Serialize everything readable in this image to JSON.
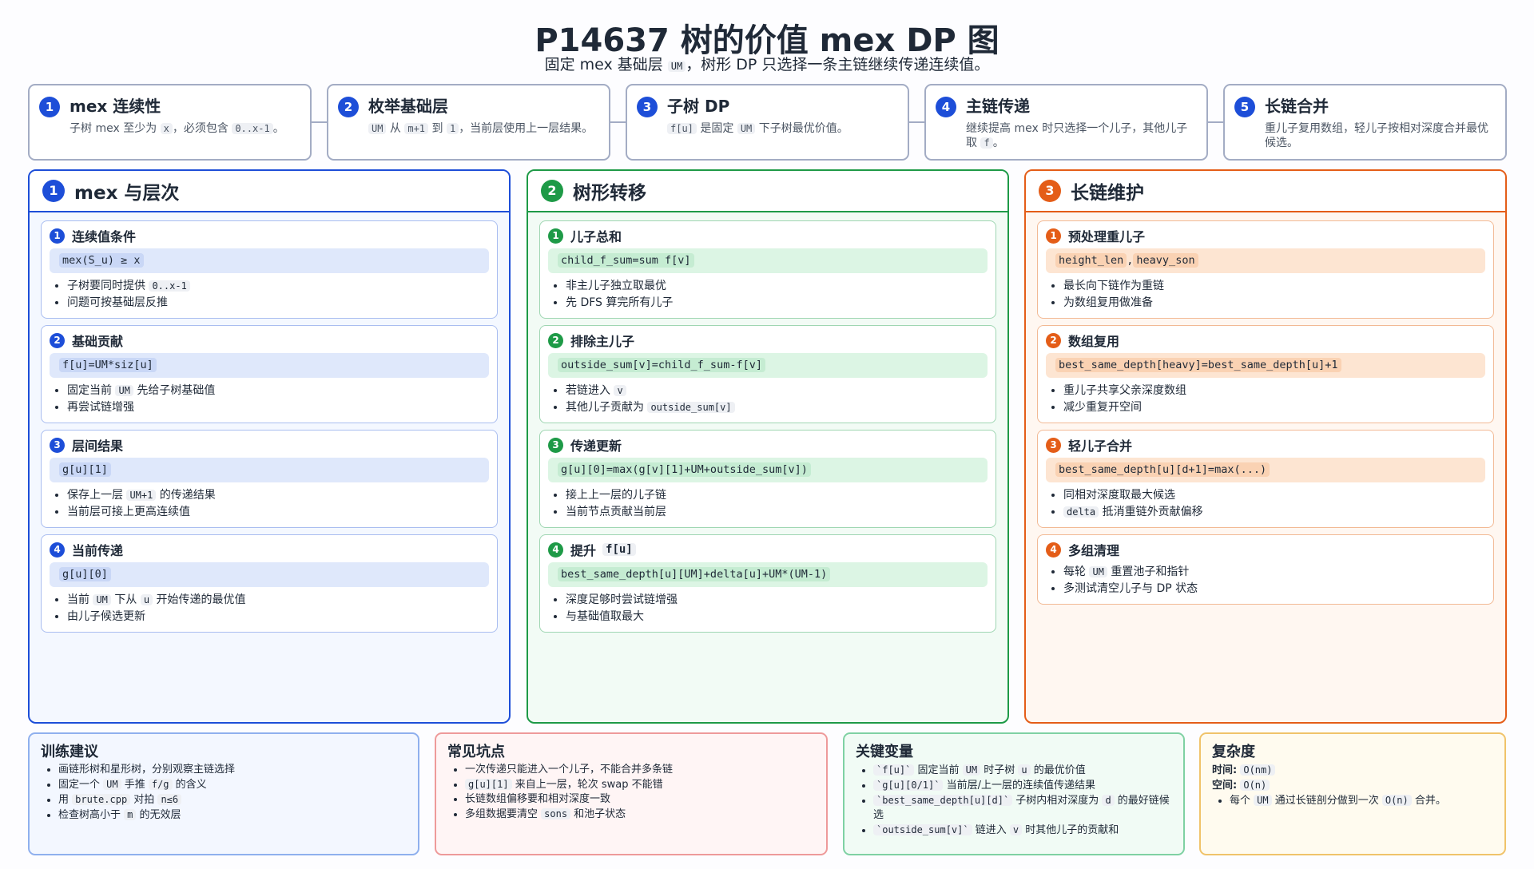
{
  "header": {
    "title": "P14637 树的价值 mex DP 图",
    "subtitle_pre": "固定 mex 基础层 ",
    "subtitle_code": "UM",
    "subtitle_post": "，树形 DP 只选择一条主链继续传递连续值。"
  },
  "steps": [
    {
      "num": "1",
      "title": "mex 连续性",
      "desc": [
        "子树 mex 至少为 ",
        {
          "c": "x"
        },
        "，必须包含 ",
        {
          "c": "0..x-1"
        },
        "。"
      ]
    },
    {
      "num": "2",
      "title": "枚举基础层",
      "desc": [
        {
          "c": "UM"
        },
        " 从 ",
        {
          "c": "m+1"
        },
        " 到 ",
        {
          "c": "1"
        },
        "，当前层使用上一层结果。"
      ]
    },
    {
      "num": "3",
      "title": "子树 DP",
      "desc": [
        {
          "c": "f[u]"
        },
        " 是固定 ",
        {
          "c": "UM"
        },
        " 下子树最优价值。"
      ]
    },
    {
      "num": "4",
      "title": "主链传递",
      "desc": [
        "继续提高 mex 时只选择一个儿子，其他儿子取 ",
        {
          "c": "f"
        },
        "。"
      ]
    },
    {
      "num": "5",
      "title": "长链合并",
      "desc": [
        "重儿子复用数组，轻儿子按相对深度合并最优候选。"
      ]
    }
  ],
  "columns": [
    {
      "num": "1",
      "title": "mex 与层次",
      "cards": [
        {
          "num": "1",
          "title": "连续值条件",
          "formula": [
            "mex(S_u) ≥ x"
          ],
          "bullets": [
            [
              "子树要同时提供 ",
              {
                "c": "0..x-1"
              }
            ],
            [
              "问题可按基础层反推"
            ]
          ]
        },
        {
          "num": "2",
          "title": "基础贡献",
          "formula": [
            "f[u]=UM*siz[u]"
          ],
          "bullets": [
            [
              "固定当前 ",
              {
                "c": "UM"
              },
              " 先给子树基础值"
            ],
            [
              "再尝试链增强"
            ]
          ]
        },
        {
          "num": "3",
          "title": "层间结果",
          "formula": [
            "g[u][1]"
          ],
          "bullets": [
            [
              "保存上一层 ",
              {
                "c": "UM+1"
              },
              " 的传递结果"
            ],
            [
              "当前层可接上更高连续值"
            ]
          ]
        },
        {
          "num": "4",
          "title": "当前传递",
          "formula": [
            "g[u][0]"
          ],
          "bullets": [
            [
              "当前 ",
              {
                "c": "UM"
              },
              " 下从 ",
              {
                "c": "u"
              },
              " 开始传递的最优值"
            ],
            [
              "由儿子候选更新"
            ]
          ]
        }
      ]
    },
    {
      "num": "2",
      "title": "树形转移",
      "cards": [
        {
          "num": "1",
          "title": "儿子总和",
          "formula": [
            "child_f_sum=sum f[v]"
          ],
          "bullets": [
            [
              "非主儿子独立取最优"
            ],
            [
              "先 DFS 算完所有儿子"
            ]
          ]
        },
        {
          "num": "2",
          "title": "排除主儿子",
          "formula": [
            "outside_sum[v]=child_f_sum-f[v]"
          ],
          "bullets": [
            [
              "若链进入 ",
              {
                "c": "v"
              }
            ],
            [
              "其他儿子贡献为 ",
              {
                "c": "outside_sum[v]"
              }
            ]
          ]
        },
        {
          "num": "3",
          "title": "传递更新",
          "formula": [
            "g[u][0]=max(g[v][1]+UM+outside_sum[v])"
          ],
          "bullets": [
            [
              "接上上一层的儿子链"
            ],
            [
              "当前节点贡献当前层"
            ]
          ]
        },
        {
          "num": "4",
          "title": "提升",
          "title_code": "f[u]",
          "formula": [
            "best_same_depth[u][UM]+delta[u]+UM*(UM-1)"
          ],
          "bullets": [
            [
              "深度足够时尝试链增强"
            ],
            [
              "与基础值取最大"
            ]
          ]
        }
      ]
    },
    {
      "num": "3",
      "title": "长链维护",
      "cards": [
        {
          "num": "1",
          "title": "预处理重儿子",
          "formula": [
            "height_len",
            ",",
            "heavy_son"
          ],
          "bullets": [
            [
              "最长向下链作为重链"
            ],
            [
              "为数组复用做准备"
            ]
          ]
        },
        {
          "num": "2",
          "title": "数组复用",
          "formula": [
            "best_same_depth[heavy]=best_same_depth[u]+1"
          ],
          "bullets": [
            [
              "重儿子共享父亲深度数组"
            ],
            [
              "减少重复开空间"
            ]
          ]
        },
        {
          "num": "3",
          "title": "轻儿子合并",
          "formula": [
            "best_same_depth[u][d+1]=max(...)"
          ],
          "bullets": [
            [
              "同相对深度取最大候选"
            ],
            [
              {
                "c": "delta"
              },
              " 抵消重链外贡献偏移"
            ]
          ]
        },
        {
          "num": "4",
          "title": "多组清理",
          "bullets": [
            [
              "每轮 ",
              {
                "c": "UM"
              },
              " 重置池子和指针"
            ],
            [
              "多测试清空儿子与 DP 状态"
            ]
          ]
        }
      ]
    }
  ],
  "bottom": {
    "training": {
      "title": "训练建议",
      "items": [
        [
          "画链形树和星形树，分别观察主链选择"
        ],
        [
          "固定一个 ",
          {
            "c": "UM"
          },
          " 手推 ",
          {
            "c": "f/g"
          },
          " 的含义"
        ],
        [
          "用 ",
          {
            "c": "brute.cpp"
          },
          " 对拍 ",
          {
            "c": "n≤6"
          }
        ],
        [
          "检查树高小于 ",
          {
            "c": "m"
          },
          " 的无效层"
        ]
      ]
    },
    "pitfalls": {
      "title": "常见坑点",
      "items": [
        [
          "一次传递只能进入一个儿子，不能合并多条链"
        ],
        [
          {
            "c": "g[u][1]"
          },
          " 来自上一层，轮次 swap 不能错"
        ],
        [
          "长链数组偏移要和相对深度一致"
        ],
        [
          "多组数据要清空 ",
          {
            "c": "sons"
          },
          " 和池子状态"
        ]
      ]
    },
    "vars": {
      "title": "关键变量",
      "items": [
        [
          {
            "c": "`f[u]`"
          },
          " 固定当前 ",
          {
            "c": "UM"
          },
          " 时子树 ",
          {
            "c": "u"
          },
          " 的最优价值"
        ],
        [
          {
            "c": "`g[u][0/1]`"
          },
          " 当前层/上一层的连续值传递结果"
        ],
        [
          {
            "c": "`best_same_depth[u][d]`"
          },
          " 子树内相对深度为 ",
          {
            "c": "d"
          },
          " 的最好链候选"
        ],
        [
          {
            "c": "`outside_sum[v]`"
          },
          " 链进入 ",
          {
            "c": "v"
          },
          " 时其他儿子的贡献和"
        ]
      ]
    },
    "complexity": {
      "title": "复杂度",
      "time_label": "时间:",
      "time_value": "O(nm)",
      "space_label": "空间:",
      "space_value": "O(n)",
      "items": [
        [
          "每个 ",
          {
            "c": "UM"
          },
          " 通过长链剖分做到一次 ",
          {
            "c": "O(n)"
          },
          " 合并。"
        ]
      ]
    }
  }
}
